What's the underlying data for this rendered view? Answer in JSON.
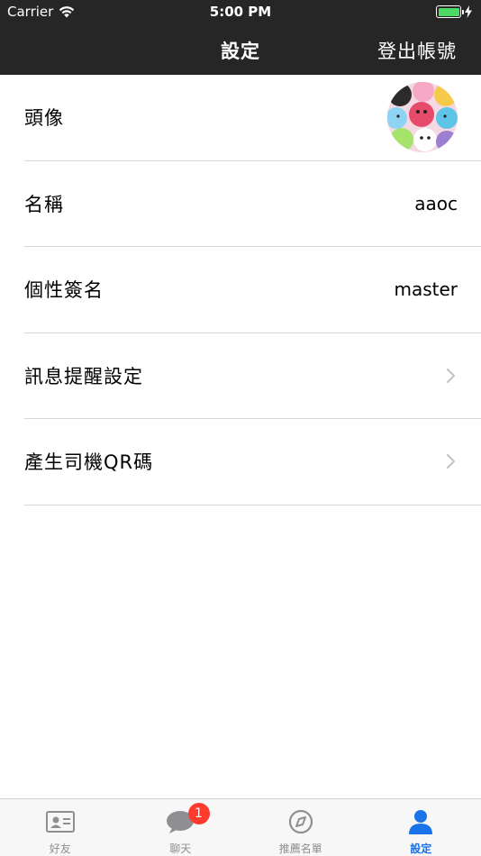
{
  "status_bar": {
    "carrier": "Carrier",
    "time": "5:00 PM",
    "battery_color": "#4cd964"
  },
  "nav": {
    "title": "設定",
    "logout_label": "登出帳號"
  },
  "settings": {
    "avatar_label": "頭像",
    "name_label": "名稱",
    "name_value": "aaoc",
    "signature_label": "個性簽名",
    "signature_value": "master",
    "notification_label": "訊息提醒設定",
    "qr_label": "產生司機QR碼"
  },
  "tabs": [
    {
      "label": "好友",
      "icon": "contact-card-icon"
    },
    {
      "label": "聊天",
      "icon": "chat-bubble-icon",
      "badge": "1"
    },
    {
      "label": "推薦名單",
      "icon": "compass-icon"
    },
    {
      "label": "設定",
      "icon": "person-icon"
    }
  ],
  "colors": {
    "bar_background": "#262626",
    "active_tab": "#1a73e8",
    "inactive_tab": "#8e8e93",
    "badge": "#ff3b30"
  }
}
